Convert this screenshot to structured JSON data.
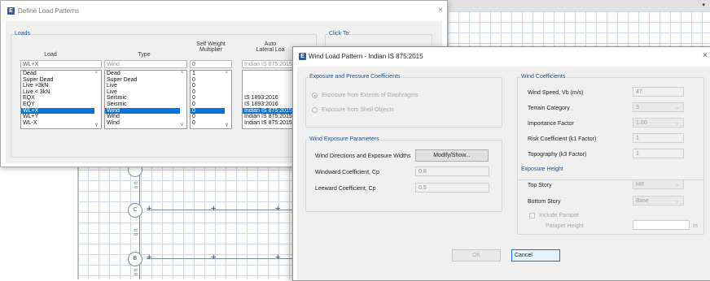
{
  "background": {
    "grid_labels": [
      "C",
      "B"
    ],
    "dimension_texts": [
      "8 ft",
      "8 ft",
      "8 ft"
    ],
    "dropdown_arrow": "▾"
  },
  "load_patterns_window": {
    "title": "Define Load Patterns",
    "icon_letter": "E",
    "close_label": "×",
    "loads_group_label": "Loads",
    "click_to_label": "Click To:",
    "columns": {
      "load": "Load",
      "type": "Type",
      "self_weight_line1": "Self Weight",
      "self_weight_line2": "Multiplier",
      "auto_line1": "Auto",
      "auto_line2": "Lateral Loa"
    },
    "current": {
      "load": "WL+X",
      "type": "Wind",
      "multiplier": "0",
      "auto_lateral": "Indian IS 875:2015"
    },
    "rows": [
      {
        "load": "Dead",
        "type": "Dead",
        "multiplier": "1",
        "auto": ""
      },
      {
        "load": "Super Dead",
        "type": "Super Dead",
        "multiplier": "0",
        "auto": ""
      },
      {
        "load": "Live >3kN",
        "type": "Live",
        "multiplier": "0",
        "auto": ""
      },
      {
        "load": "Live < 3kN",
        "type": "Live",
        "multiplier": "0",
        "auto": ""
      },
      {
        "load": "EQX",
        "type": "Seismic",
        "multiplier": "0",
        "auto": "IS 1893:2016"
      },
      {
        "load": "EQY",
        "type": "Seismic",
        "multiplier": "0",
        "auto": "IS 1893:2016"
      },
      {
        "load": "WL+X",
        "type": "Wind",
        "multiplier": "0",
        "auto": "Indian IS 875:2015",
        "selected": true
      },
      {
        "load": "WL+Y",
        "type": "Wind",
        "multiplier": "0",
        "auto": "Indian IS 875:2015"
      },
      {
        "load": "WL-X",
        "type": "Wind",
        "multiplier": "0",
        "auto": "Indian IS 875:2015"
      }
    ]
  },
  "wind_dialog": {
    "title": "Wind Load Pattern - Indian IS 875:2015",
    "icon_letter": "E",
    "close_label": "×",
    "exposure_group": {
      "label": "Exposure and Pressure Coefficients",
      "option_diaphragms": "Exposure from Extents of Diaphragms",
      "option_shell": "Exposure from Shell Objects"
    },
    "wind_exposure_group": {
      "label": "Wind Exposure Parameters",
      "directions_label": "Wind Directions and Exposure Widths",
      "modify_button": "Modify/Show...",
      "windward_label": "Windward Coefficient, Cp",
      "windward_value": "0.8",
      "leeward_label": "Leeward Coefficient, Cp",
      "leeward_value": "0.5"
    },
    "wind_coefficients_group": {
      "label": "Wind Coefficients",
      "speed_label": "Wind Speed, Vb (m/s)",
      "speed_value": "47",
      "terrain_label": "Terrain Category",
      "terrain_value": "3",
      "importance_label": "Importance Factor",
      "importance_value": "1.00",
      "risk_label": "Risk Coefficient (k1 Factor)",
      "risk_value": "1",
      "topography_label": "Topography (k3 Factor)",
      "topography_value": "1"
    },
    "exposure_height_group": {
      "label": "Exposure Height",
      "top_story_label": "Top Story",
      "top_story_value": "HR",
      "bottom_story_label": "Bottom Story",
      "bottom_story_value": "Base",
      "include_parapet_label": "Include Parapet",
      "parapet_height_label": "Parapet Height",
      "parapet_unit": "m"
    },
    "ok_button": "OK",
    "cancel_button": "Cancel"
  },
  "colors": {
    "selection": "#0a74d8",
    "group_label": "#1a4f8f",
    "app_icon": "#1c5fb5"
  }
}
